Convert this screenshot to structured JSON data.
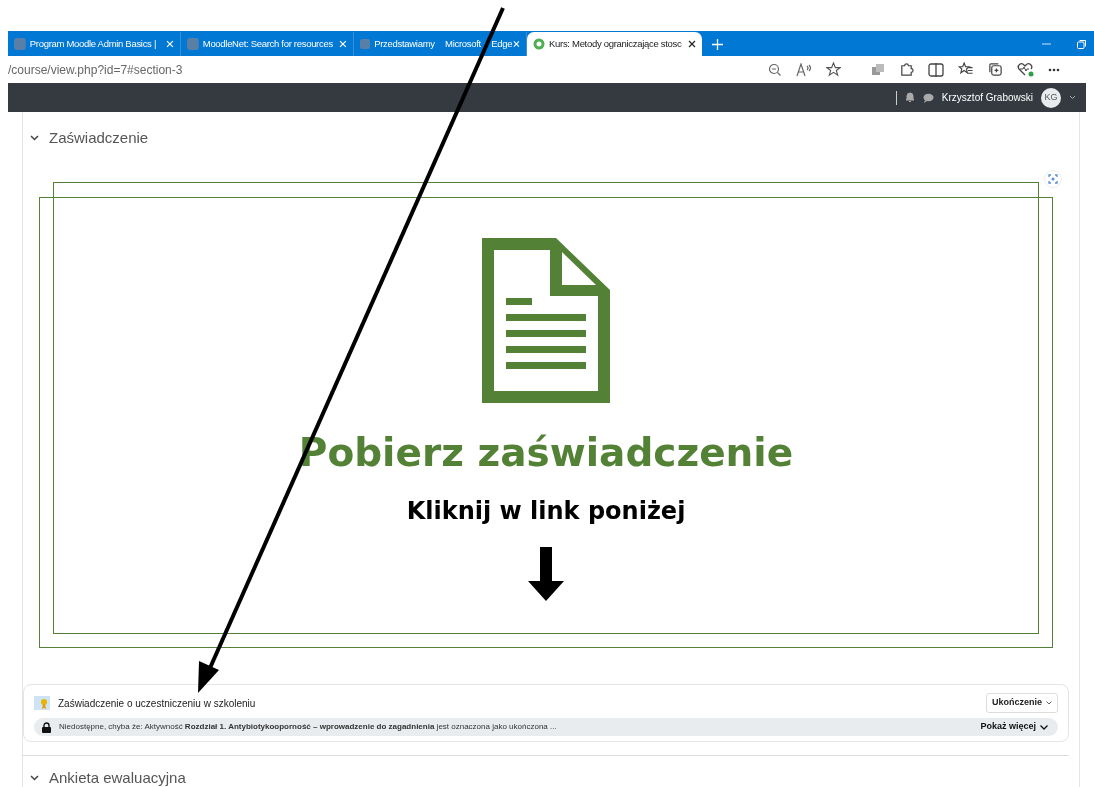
{
  "browser": {
    "tabs": [
      {
        "title": "Program Moodle Admin Basics |",
        "selected": false
      },
      {
        "title": "MoodleNet: Search for resources",
        "selected": false
      },
      {
        "title": "Przedstawiamy Microsoft Edge",
        "selected": false
      },
      {
        "title": "Kurs: Metody ograniczające stosc",
        "selected": true
      }
    ],
    "address": "/course/view.php?id=7#section-3"
  },
  "header": {
    "user_name": "Krzysztof Grabowski",
    "initials": "KG"
  },
  "section": {
    "title": "Zaświadczenie",
    "banner": {
      "title": "Pobierz zaświadczenie",
      "subtitle": "Kliknij w link poniżej"
    },
    "activity": {
      "name": "Zaświadczenie o uczestniczeniu w szkoleniu",
      "completion": "Ukończenie",
      "restriction": "Niedostępne, chyba że: Aktywność **Rozdział 1. Antybiotykooporność – wprowadzenie do zagadnienia** jest oznaczona jako ukończona ...",
      "show_more": "Pokaż więcej"
    }
  },
  "next_section": {
    "title": "Ankieta ewaluacyjna"
  }
}
